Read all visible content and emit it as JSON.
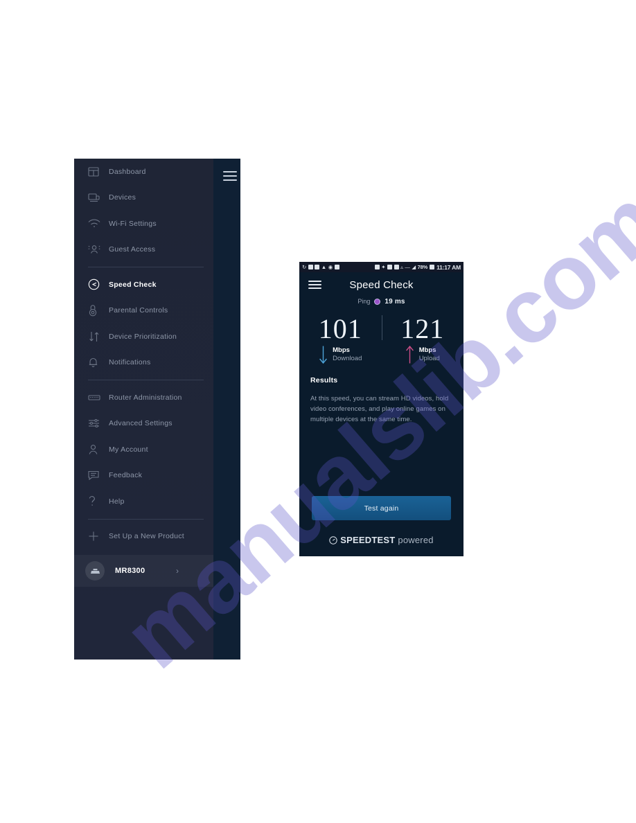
{
  "sidebar": {
    "hamburger_icon": "hamburger-menu-icon",
    "items": [
      {
        "label": "Dashboard",
        "icon": "dashboard-icon",
        "active": false
      },
      {
        "label": "Devices",
        "icon": "devices-icon",
        "active": false
      },
      {
        "label": "Wi-Fi Settings",
        "icon": "wifi-icon",
        "active": false
      },
      {
        "label": "Guest Access",
        "icon": "guest-users-icon",
        "active": false
      },
      {
        "label": "Speed Check",
        "icon": "speedometer-icon",
        "active": true
      },
      {
        "label": "Parental Controls",
        "icon": "parental-controls-icon",
        "active": false
      },
      {
        "label": "Device Prioritization",
        "icon": "up-down-arrows-icon",
        "active": false
      },
      {
        "label": "Notifications",
        "icon": "bell-icon",
        "active": false
      },
      {
        "label": "Router Administration",
        "icon": "router-icon",
        "active": false
      },
      {
        "label": "Advanced Settings",
        "icon": "sliders-icon",
        "active": false
      },
      {
        "label": "My Account",
        "icon": "person-icon",
        "active": false
      },
      {
        "label": "Feedback",
        "icon": "chat-bubble-icon",
        "active": false
      },
      {
        "label": "Help",
        "icon": "question-mark-icon",
        "active": false
      },
      {
        "label": "Set Up a New Product",
        "icon": "plus-icon",
        "active": false
      }
    ],
    "device": {
      "name": "MR8300",
      "avatar_icon": "router-device-icon",
      "chevron_icon": "chevron-right-icon"
    },
    "colors": {
      "panel_bg": "#20263a",
      "rail_bg": "#0f2034",
      "label": "#8e97a8",
      "active_label": "#ffffff"
    }
  },
  "phone": {
    "status_bar": {
      "left_icons": [
        "sync-icon",
        "screenshot-icon",
        "vpn-icon",
        "app-icon",
        "messages-icon",
        "email-icon"
      ],
      "right_icons": [
        "silent-icon",
        "bluetooth-icon",
        "nfc-icon",
        "alarm-icon",
        "wifi-icon",
        "data-icon",
        "signal-icon"
      ],
      "battery_percent": "78%",
      "battery_icon": "battery-icon",
      "time": "11:17 AM"
    },
    "header": {
      "menu_icon": "hamburger-menu-icon",
      "title": "Speed Check"
    },
    "ping": {
      "label": "Ping",
      "indicator_icon": "ping-dot-icon",
      "value": "19 ms",
      "dot_color": "#9a53c9"
    },
    "speeds": [
      {
        "value": "101",
        "unit": "Mbps",
        "direction": "Download",
        "arrow_icon": "arrow-down-icon",
        "arrow_color": "#4da3d8"
      },
      {
        "value": "121",
        "unit": "Mbps",
        "direction": "Upload",
        "arrow_icon": "arrow-up-icon",
        "arrow_color": "#c94d86"
      }
    ],
    "results": {
      "title": "Results",
      "text": "At this speed, you can stream HD videos, hold video conferences, and play online games on multiple devices at the same time."
    },
    "test_again_label": "Test again",
    "footer": {
      "logo_icon": "speedtest-gauge-icon",
      "brand": "SPEEDTEST",
      "powered": "powered",
      "trademark": "™"
    },
    "colors": {
      "background": "#0a1b2c",
      "button": "#165a8c",
      "status_bar": "#121828"
    }
  },
  "watermark": {
    "text": "manualslib.com",
    "color": "#5a56c8"
  }
}
